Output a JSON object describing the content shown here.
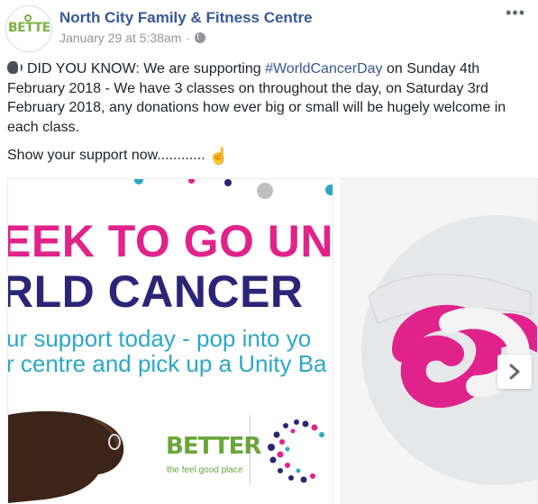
{
  "post": {
    "page_name": "North City Family & Fitness Centre",
    "timestamp": "January 29 at 5:38am",
    "separator": "·",
    "more_label": "•••",
    "avatar_text": "BETTER",
    "text_line1_prefix": "DID YOU KNOW: We are supporting ",
    "hashtag": "#WorldCancerDay",
    "text_line1_suffix": " on Sunday 4th February 2018 - We have 3 classes on throughout the day, on Saturday 3rd February 2018, any donations how ever big or small will be hugely welcome in each class.",
    "text_line2": "Show your support now............",
    "icons": [
      "speaking-head-icon",
      "pointing-hand-icon",
      "globe-icon"
    ]
  },
  "media": {
    "photo1": {
      "headline_1": "EEK TO GO UN",
      "headline_2": "RLD CANCER",
      "tagline_1": "ur support today - pop into yo",
      "tagline_2": "r centre and pick up a Unity Ba",
      "logo_text": "BETTER",
      "logo_tagline": "the feel good place"
    },
    "next_button_icon": "chevron-right-icon"
  },
  "colors": {
    "link": "#365899",
    "pink": "#e0238a",
    "navy": "#2a2677",
    "teal": "#2ca8c7",
    "green": "#6aa63a"
  }
}
